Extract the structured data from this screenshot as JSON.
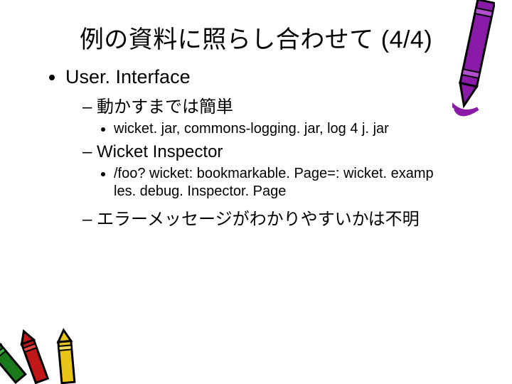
{
  "title": "例の資料に照らし合わせて (4/4)",
  "bullets": {
    "l1_0": "User. Interface",
    "l2_0": "動かすまでは簡単",
    "l3_0": "wicket. jar, commons-logging. jar, log 4 j. jar",
    "l2_1": "Wicket Inspector",
    "l3_1a": "/foo? wicket: bookmarkable. Page=: wicket. examp",
    "l3_1b": "les. debug. Inspector. Page",
    "l2_2": "エラーメッセージがわかりやすいかは不明"
  }
}
